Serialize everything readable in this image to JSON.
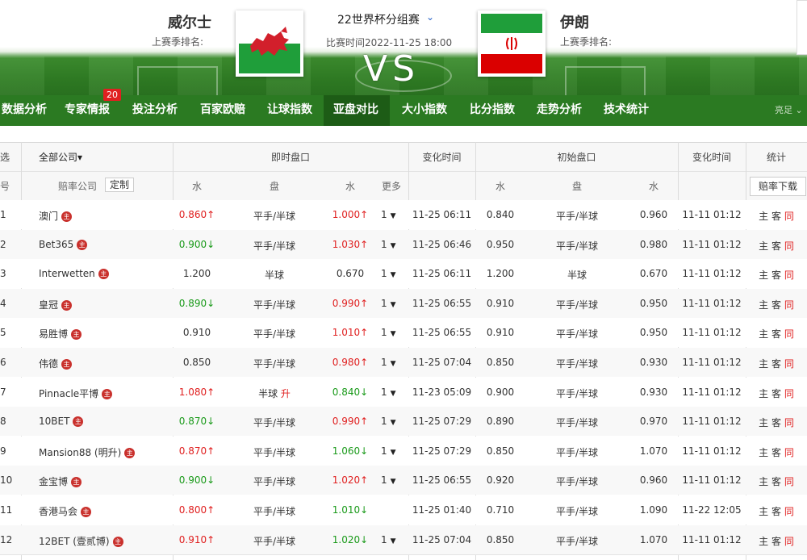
{
  "header": {
    "home_team": "威尔士",
    "away_team": "伊朗",
    "home_rank_label": "上赛季排名:",
    "away_rank_label": "上赛季排名:",
    "league": "22世界杯分组赛",
    "league_chevron": "⌄",
    "match_time": "比赛时间2022-11-25 18:00",
    "vs": "VS"
  },
  "nav": {
    "items": [
      "数据分析",
      "专家情报",
      "投注分析",
      "百家欧赔",
      "让球指数",
      "亚盘对比",
      "大小指数",
      "比分指数",
      "走势分析",
      "技术统计"
    ],
    "badge": "20",
    "more": "亮足 ⌄"
  },
  "table": {
    "header": {
      "select": "选",
      "all_companies": "全部公司▾",
      "live": "即时盘口",
      "change_time": "变化时间",
      "initial": "初始盘口",
      "change_time2": "变化时间",
      "stats": "统计"
    },
    "subheader": {
      "no": "号",
      "company": "赔率公司",
      "customize": "定制",
      "water1": "水",
      "handicap": "盘",
      "water2": "水",
      "more": "更多",
      "i_water1": "水",
      "i_handicap": "盘",
      "i_water2": "水",
      "download": "赔率下载"
    },
    "icon_label": "主",
    "stat_home": "主",
    "stat_away": "客",
    "stat_same": "同",
    "rows": [
      {
        "no": "1",
        "company": "澳门",
        "w1": "0.860",
        "w1d": "↑",
        "pan": "平手/半球",
        "pand": "",
        "w2": "1.000",
        "w2d": "↑",
        "more": "1",
        "time": "11-25 06:11",
        "iw1": "0.840",
        "ipan": "平手/半球",
        "iw2": "0.960",
        "itime": "11-11 01:12"
      },
      {
        "no": "2",
        "company": "Bet365",
        "w1": "0.900",
        "w1d": "↓",
        "pan": "平手/半球",
        "pand": "",
        "w2": "1.030",
        "w2d": "↑",
        "more": "1",
        "time": "11-25 06:46",
        "iw1": "0.950",
        "ipan": "平手/半球",
        "iw2": "0.980",
        "itime": "11-11 01:12"
      },
      {
        "no": "3",
        "company": "Interwetten",
        "w1": "1.200",
        "w1d": "",
        "pan": "半球",
        "pand": "",
        "w2": "0.670",
        "w2d": "",
        "more": "1",
        "time": "11-25 06:11",
        "iw1": "1.200",
        "ipan": "半球",
        "iw2": "0.670",
        "itime": "11-11 01:12"
      },
      {
        "no": "4",
        "company": "皇冠",
        "w1": "0.890",
        "w1d": "↓",
        "pan": "平手/半球",
        "pand": "",
        "w2": "0.990",
        "w2d": "↑",
        "more": "1",
        "time": "11-25 06:55",
        "iw1": "0.910",
        "ipan": "平手/半球",
        "iw2": "0.950",
        "itime": "11-11 01:12"
      },
      {
        "no": "5",
        "company": "易胜博",
        "w1": "0.910",
        "w1d": "",
        "pan": "平手/半球",
        "pand": "",
        "w2": "1.010",
        "w2d": "↑",
        "more": "1",
        "time": "11-25 06:55",
        "iw1": "0.910",
        "ipan": "平手/半球",
        "iw2": "0.950",
        "itime": "11-11 01:12"
      },
      {
        "no": "6",
        "company": "伟德",
        "w1": "0.850",
        "w1d": "",
        "pan": "平手/半球",
        "pand": "",
        "w2": "0.980",
        "w2d": "↑",
        "more": "1",
        "time": "11-25 07:04",
        "iw1": "0.850",
        "ipan": "平手/半球",
        "iw2": "0.930",
        "itime": "11-11 01:12"
      },
      {
        "no": "7",
        "company": "Pinnacle平博",
        "w1": "1.080",
        "w1d": "↑",
        "pan": "半球",
        "pand": "升",
        "w2": "0.840",
        "w2d": "↓",
        "more": "1",
        "time": "11-23 05:09",
        "iw1": "0.900",
        "ipan": "平手/半球",
        "iw2": "0.930",
        "itime": "11-11 01:12"
      },
      {
        "no": "8",
        "company": "10BET",
        "w1": "0.870",
        "w1d": "↓",
        "pan": "平手/半球",
        "pand": "",
        "w2": "0.990",
        "w2d": "↑",
        "more": "1",
        "time": "11-25 07:29",
        "iw1": "0.890",
        "ipan": "平手/半球",
        "iw2": "0.970",
        "itime": "11-11 01:12"
      },
      {
        "no": "9",
        "company": "Mansion88 (明升)",
        "w1": "0.870",
        "w1d": "↑",
        "pan": "平手/半球",
        "pand": "",
        "w2": "1.060",
        "w2d": "↓",
        "more": "1",
        "time": "11-25 07:29",
        "iw1": "0.850",
        "ipan": "平手/半球",
        "iw2": "1.070",
        "itime": "11-11 01:12"
      },
      {
        "no": "10",
        "company": "金宝博",
        "w1": "0.900",
        "w1d": "↓",
        "pan": "平手/半球",
        "pand": "",
        "w2": "1.020",
        "w2d": "↑",
        "more": "1",
        "time": "11-25 06:55",
        "iw1": "0.920",
        "ipan": "平手/半球",
        "iw2": "0.960",
        "itime": "11-11 01:12"
      },
      {
        "no": "11",
        "company": "香港马会",
        "w1": "0.800",
        "w1d": "↑",
        "pan": "平手/半球",
        "pand": "",
        "w2": "1.010",
        "w2d": "↓",
        "more": "",
        "time": "11-25 01:40",
        "iw1": "0.710",
        "ipan": "平手/半球",
        "iw2": "1.090",
        "itime": "11-22 12:05"
      },
      {
        "no": "12",
        "company": "12BET (壹贰博)",
        "w1": "0.910",
        "w1d": "↑",
        "pan": "平手/半球",
        "pand": "",
        "w2": "1.020",
        "w2d": "↓",
        "more": "1",
        "time": "11-25 07:04",
        "iw1": "0.850",
        "ipan": "平手/半球",
        "iw2": "1.070",
        "itime": "11-11 01:12"
      }
    ]
  },
  "colors": {
    "up": "#e02020",
    "down": "#1a9a1a",
    "nav_bg": "#2b7a22",
    "nav_active": "#1d5c16"
  }
}
